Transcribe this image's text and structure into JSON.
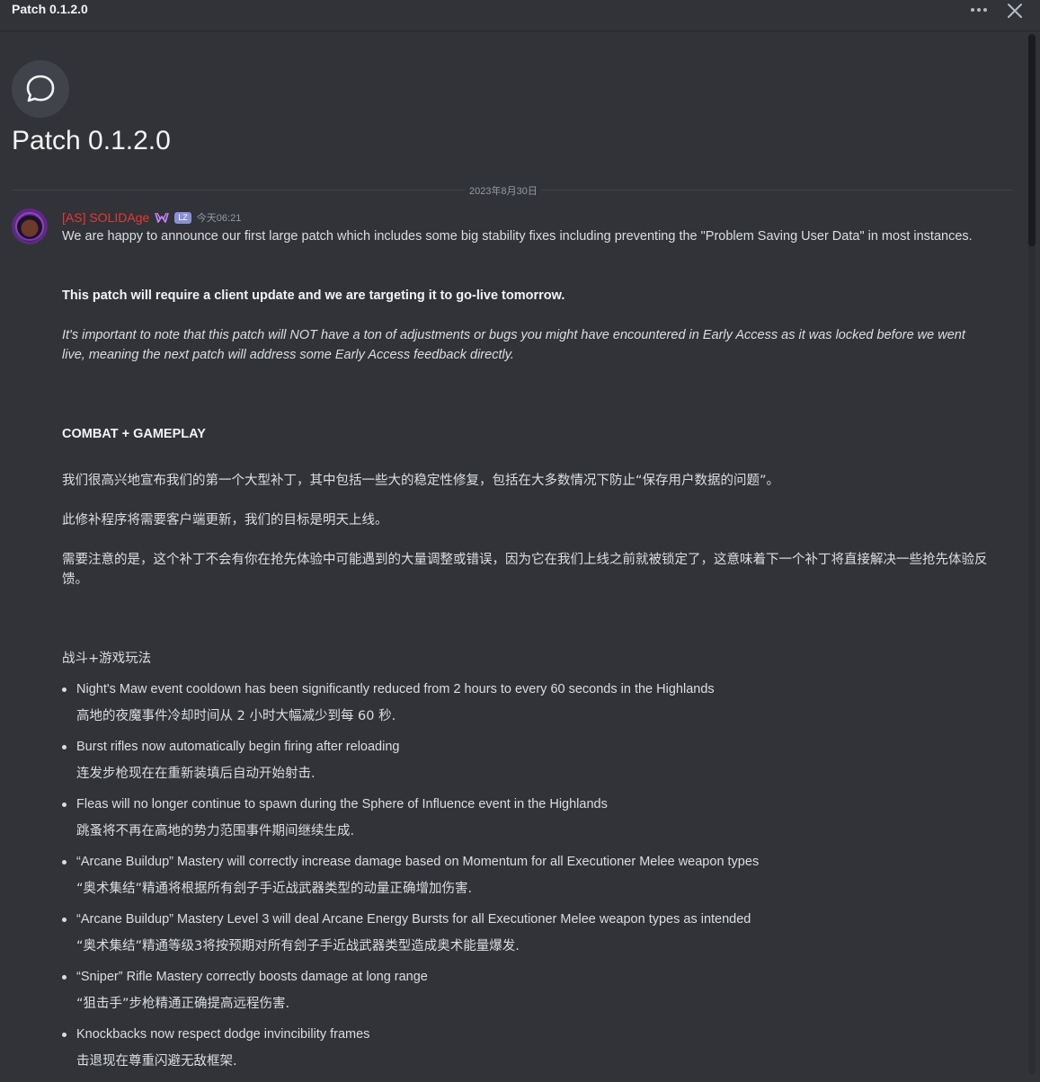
{
  "window": {
    "title": "Patch 0.1.2.0"
  },
  "thread": {
    "title": "Patch 0.1.2.0",
    "icon": "chat-bubble-icon"
  },
  "divider": {
    "date": "2023年8月30日"
  },
  "message": {
    "author": "[AS] SOLIDAge",
    "author_color": "#e53935",
    "tag": "LZ",
    "timestamp": "今天06:21",
    "intro": "We are happy to announce our first large patch which includes some big stability fixes including preventing the \"Problem Saving User Data\" in most instances.",
    "bold_line": "This patch will require a client update and we are targeting it to go-live tomorrow.",
    "italic_note": "It's important to note that this patch will NOT have a ton of adjustments or bugs you might have encountered in Early Access as it was locked before we went live, meaning the next patch will address some Early Access feedback directly.",
    "section_heading": "COMBAT + GAMEPLAY",
    "zh_intro": "我们很高兴地宣布我们的第一个大型补丁，其中包括一些大的稳定性修复，包括在大多数情况下防止“保存用户数据的问题”。",
    "zh_bold": "此修补程序将需要客户端更新，我们的目标是明天上线。",
    "zh_note": "需要注意的是，这个补丁不会有你在抢先体验中可能遇到的大量调整或错误，因为它在我们上线之前就被锁定了，这意味着下一个补丁将直接解决一些抢先体验反馈。",
    "zh_section_heading": "战斗+游戏玩法",
    "items": [
      {
        "en": "Night's Maw event cooldown has been significantly reduced from 2 hours to every 60 seconds in the Highlands",
        "zh": "高地的夜魔事件冷却时间从 2 小时大幅减少到每 60 秒."
      },
      {
        "en": "Burst rifles now automatically begin firing after reloading",
        "zh": "连发步枪现在在重新装填后自动开始射击."
      },
      {
        "en": "Fleas will no longer continue to spawn during the Sphere of Influence event in the Highlands",
        "zh": "跳蚤将不再在高地的势力范围事件期间继续生成."
      },
      {
        "en": "“Arcane Buildup” Mastery will correctly increase damage based on Momentum for all Executioner Melee weapon types",
        "zh": "“奥术集结”精通将根据所有刽子手近战武器类型的动量正确增加伤害."
      },
      {
        "en": "“Arcane Buildup” Mastery Level 3 will deal Arcane Energy Bursts for all Executioner Melee weapon types as intended",
        "zh": "“奥术集结”精通等级3将按预期对所有刽子手近战武器类型造成奥术能量爆发."
      },
      {
        "en": "“Sniper” Rifle Mastery correctly boosts damage at long range",
        "zh": "“狙击手”步枪精通正确提高远程伤害."
      },
      {
        "en": "Knockbacks now respect dodge invincibility frames",
        "zh": "击退现在尊重闪避无敌框架."
      }
    ]
  }
}
